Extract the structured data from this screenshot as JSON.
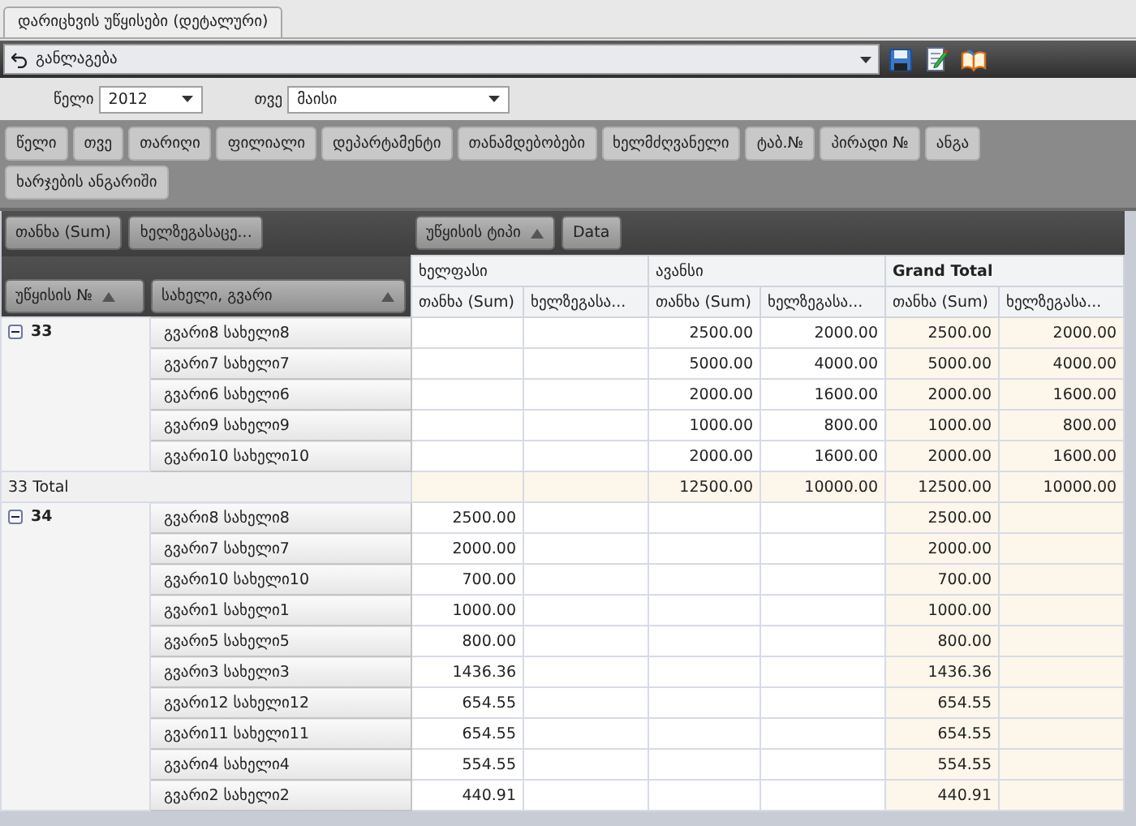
{
  "tabs": [
    {
      "label": "დარიცხვის უწყისები (დეტალური)"
    }
  ],
  "toolbar": {
    "layout_label": "განლაგება"
  },
  "filters": [
    {
      "label": "წელი",
      "value": "2012"
    },
    {
      "label": "თვე",
      "value": "მაისი"
    }
  ],
  "field_list": [
    "წელი",
    "თვე",
    "თარიღი",
    "ფილიალი",
    "დეპარტამენტი",
    "თანამდებობები",
    "ხელმძღვანელი",
    "ტაბ.№",
    "პირადი №",
    "ანგა",
    "ხარჯების ანგარიში"
  ],
  "data_fields": [
    "თანხა (Sum)",
    "ხელზეგასაცე..."
  ],
  "column_fields": [
    {
      "label": "უწყისის ტიპი",
      "sorted": true
    },
    {
      "label": "Data"
    }
  ],
  "row_fields": [
    {
      "label": "უწყისის №",
      "sorted": true
    },
    {
      "label": "სახელი, გვარი",
      "sorted": true
    }
  ],
  "table": {
    "column_groups": [
      {
        "label": "ხელფასი",
        "kind": "normal"
      },
      {
        "label": "ავანსი",
        "kind": "normal"
      },
      {
        "label": "Grand Total",
        "kind": "total"
      }
    ],
    "subcolumns": [
      "თანხა (Sum)",
      "ხელზეგასა...",
      "თანხა (Sum)",
      "ხელზეგასა...",
      "თანხა (Sum)",
      "ხელზეგასა..."
    ],
    "groups": [
      {
        "key": "33",
        "expanded": true,
        "rows": [
          {
            "name": "გვარი8 სახელი8",
            "cells": {
              "advance_sum": "2500.00",
              "advance_handout": "2000.00",
              "total_sum": "2500.00",
              "total_handout": "2000.00"
            }
          },
          {
            "name": "გვარი7 სახელი7",
            "cells": {
              "advance_sum": "5000.00",
              "advance_handout": "4000.00",
              "total_sum": "5000.00",
              "total_handout": "4000.00"
            }
          },
          {
            "name": "გვარი6 სახელი6",
            "cells": {
              "advance_sum": "2000.00",
              "advance_handout": "1600.00",
              "total_sum": "2000.00",
              "total_handout": "1600.00"
            }
          },
          {
            "name": "გვარი9 სახელი9",
            "cells": {
              "advance_sum": "1000.00",
              "advance_handout": "800.00",
              "total_sum": "1000.00",
              "total_handout": "800.00"
            }
          },
          {
            "name": "გვარი10 სახელი10",
            "cells": {
              "advance_sum": "2000.00",
              "advance_handout": "1600.00",
              "total_sum": "2000.00",
              "total_handout": "1600.00"
            }
          }
        ],
        "total": {
          "label": "33 Total",
          "cells": {
            "advance_sum": "12500.00",
            "advance_handout": "10000.00",
            "total_sum": "12500.00",
            "total_handout": "10000.00"
          }
        }
      },
      {
        "key": "34",
        "expanded": true,
        "rows": [
          {
            "name": "გვარი8 სახელი8",
            "cells": {
              "salary_sum": "2500.00",
              "total_sum": "2500.00"
            }
          },
          {
            "name": "გვარი7 სახელი7",
            "cells": {
              "salary_sum": "2000.00",
              "total_sum": "2000.00"
            }
          },
          {
            "name": "გვარი10 სახელი10",
            "cells": {
              "salary_sum": "700.00",
              "total_sum": "700.00"
            }
          },
          {
            "name": "გვარი1 სახელი1",
            "cells": {
              "salary_sum": "1000.00",
              "total_sum": "1000.00"
            }
          },
          {
            "name": "გვარი5 სახელი5",
            "cells": {
              "salary_sum": "800.00",
              "total_sum": "800.00"
            }
          },
          {
            "name": "გვარი3 სახელი3",
            "cells": {
              "salary_sum": "1436.36",
              "total_sum": "1436.36"
            }
          },
          {
            "name": "გვარი12 სახელი12",
            "cells": {
              "salary_sum": "654.55",
              "total_sum": "654.55"
            }
          },
          {
            "name": "გვარი11 სახელი11",
            "cells": {
              "salary_sum": "654.55",
              "total_sum": "654.55"
            }
          },
          {
            "name": "გვარი4 სახელი4",
            "cells": {
              "salary_sum": "554.55",
              "total_sum": "554.55"
            }
          },
          {
            "name": "გვარი2 სახელი2",
            "cells": {
              "salary_sum": "440.91",
              "total_sum": "440.91"
            }
          }
        ]
      }
    ]
  }
}
